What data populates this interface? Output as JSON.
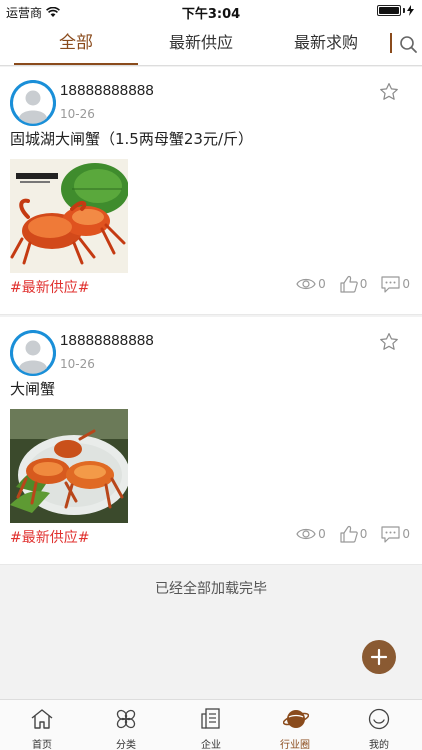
{
  "status_bar": {
    "carrier": "运营商",
    "time": "下午3:04"
  },
  "tabs": [
    {
      "label": "全部",
      "active": true
    },
    {
      "label": "最新供应",
      "active": false
    },
    {
      "label": "最新求购",
      "active": false
    }
  ],
  "posts": [
    {
      "username": "18888888888",
      "date": "10-26",
      "text": "固城湖大闸蟹（1.5两母蟹23元/斤）",
      "hashtag": "#最新供应#",
      "views": "0",
      "likes": "0",
      "comments": "0",
      "image": "crab-photo-green-leaf"
    },
    {
      "username": "18888888888",
      "date": "10-26",
      "text": "大闸蟹",
      "hashtag": "#最新供应#",
      "views": "0",
      "likes": "0",
      "comments": "0",
      "image": "crab-photo-plate"
    }
  ],
  "footer_message": "已经全部加载完毕",
  "bottom_nav": [
    {
      "label": "首页",
      "icon": "home-icon",
      "active": false
    },
    {
      "label": "分类",
      "icon": "category-icon",
      "active": false
    },
    {
      "label": "企业",
      "icon": "enterprise-icon",
      "active": false
    },
    {
      "label": "行业圈",
      "icon": "industry-circle-icon",
      "active": true
    },
    {
      "label": "我的",
      "icon": "profile-icon",
      "active": false
    }
  ],
  "colors": {
    "accent": "#8a4b1c",
    "hashtag": "#e0312f",
    "avatar": "#1a8fd8"
  }
}
